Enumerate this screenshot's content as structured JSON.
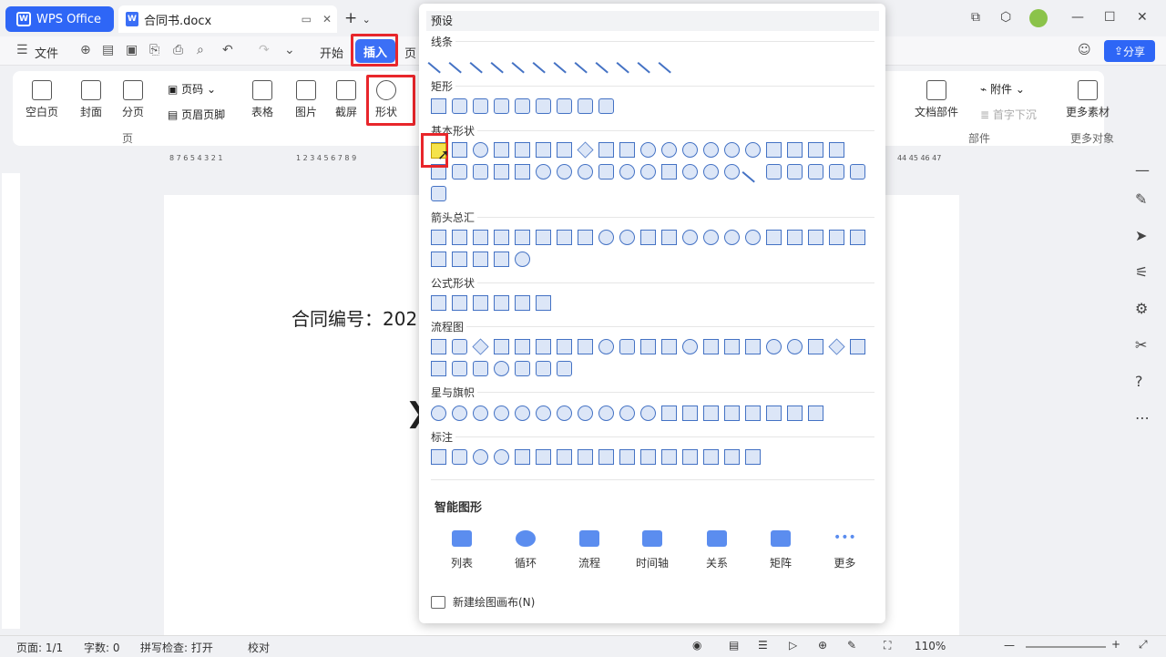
{
  "titlebar": {
    "app": "WPS Office",
    "doc_tab": "合同书.docx"
  },
  "menu": {
    "file": "文件",
    "start": "开始",
    "insert": "插入",
    "page_partial": "页",
    "share": "分享"
  },
  "ribbon": {
    "buttons": [
      "空白页",
      "封面",
      "分页",
      "页码",
      "页眉页脚",
      "表格",
      "图片",
      "截屏",
      "形状",
      "附件",
      "首字下沉",
      "文档部件",
      "更多素材"
    ],
    "groups": {
      "page": "页",
      "parts": "部件",
      "more": "更多对象"
    }
  },
  "ruler": {
    "left": "8 7 6 5 4 3 2 1",
    "right": "1 2 3 4 5 6 7 8 9",
    "far": "44 45 46 47"
  },
  "document": {
    "text": "合同编号：202"
  },
  "panel": {
    "header": "预设",
    "sections": {
      "lines": "线条",
      "rect": "矩形",
      "basic": "基本形状",
      "arrows": "箭头总汇",
      "formula": "公式形状",
      "flow": "流程图",
      "stars": "星与旗帜",
      "callouts": "标注"
    },
    "smart_title": "智能图形",
    "smart_items": [
      "列表",
      "循环",
      "流程",
      "时间轴",
      "关系",
      "矩阵",
      "更多"
    ],
    "new_canvas": "新建绘图画布(N)"
  },
  "status": {
    "page": "页面: 1/1",
    "words": "字数: 0",
    "spell": "拼写检查: 打开",
    "proof": "校对",
    "zoom": "110%"
  },
  "colors": {
    "accent": "#2e66f6",
    "highlight": "#e8262b",
    "shape_stroke": "#4472c4"
  }
}
